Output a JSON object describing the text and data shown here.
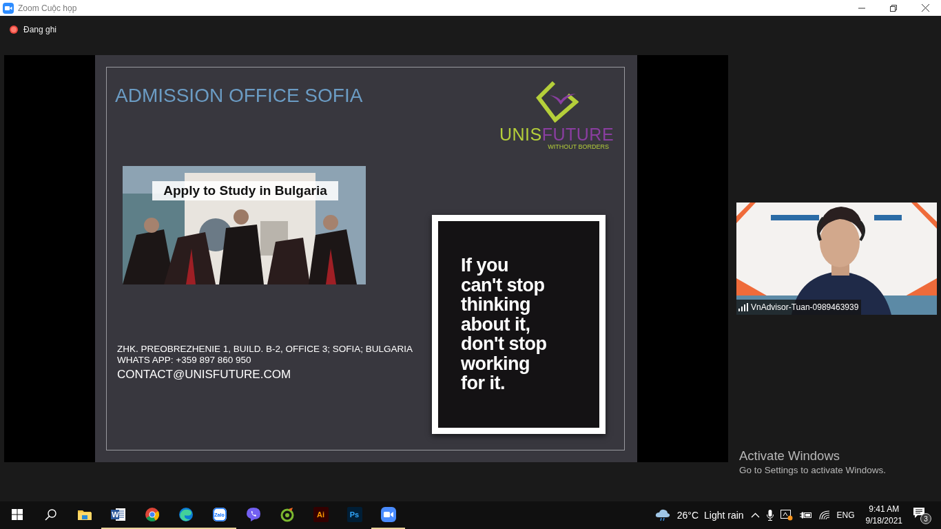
{
  "window": {
    "title": "Zoom Cuộc họp"
  },
  "recording": {
    "label": "Đang ghi",
    "on": true
  },
  "slide": {
    "title": "ADMISSION OFFICE SOFIA",
    "logo": {
      "name_lead": "UNIS",
      "name_tail": "FUTURE",
      "tagline": "WITHOUT BORDERS"
    },
    "photo": {
      "kind": "picture",
      "caption": "Apply to Study in Bulgaria"
    },
    "contact": [
      "ZHK. PREOBREZHENIE 1, BUILD. B-2, OFFICE 3; SOFIA; BULGARIA",
      "WHATS APP: +359 897 860 950",
      "CONTACT@UNISFUTURE.COM"
    ],
    "poster": {
      "lines": [
        "If you",
        "can't stop",
        "thinking",
        "about it,",
        "don't stop",
        "working",
        "for it."
      ]
    }
  },
  "video": {
    "kind": "picture",
    "participant": "VnAdvisor-Tuan-0989463939"
  },
  "activation": {
    "title": "Activate Windows",
    "hint": "Go to Settings to activate Windows."
  },
  "taskbar": {
    "apps": [
      {
        "kind": "explorer",
        "running": false
      },
      {
        "kind": "word",
        "glyph": "W",
        "running": true
      },
      {
        "kind": "chrome",
        "running": true
      },
      {
        "kind": "edge",
        "running": true
      },
      {
        "kind": "zalo",
        "glyph": "Zalo",
        "running": true
      },
      {
        "kind": "viber",
        "running": false
      },
      {
        "kind": "coccoc",
        "running": false
      },
      {
        "kind": "illustrator",
        "glyph": "Ai",
        "running": false
      },
      {
        "kind": "photoshop",
        "glyph": "Ps",
        "running": false
      },
      {
        "kind": "zoom",
        "running": true
      }
    ],
    "weather": {
      "temperature": "26°C",
      "condition": "Light rain"
    },
    "language": "ENG",
    "time": "9:41 AM",
    "date": "9/18/2021",
    "notifications": "3"
  }
}
